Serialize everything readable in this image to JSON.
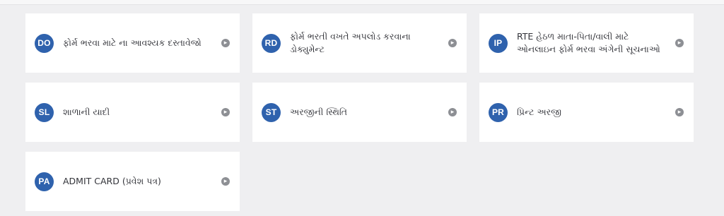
{
  "cards": [
    {
      "badge": "DO",
      "label": "ફોર્મ ભરવા માટે ના આવશ્યક દસ્તાવેજો",
      "arrow_icon": "arrow-right-circle-icon"
    },
    {
      "badge": "RD",
      "label": "ફોર્મ ભરતી વખતે અપલોડ કરવાના ડોક્યુમેન્ટ",
      "arrow_icon": "arrow-right-circle-icon"
    },
    {
      "badge": "IP",
      "label": "RTE હેઠળ માતા-પિતા/વાલી માટે ઓનલાઇન ફોર્મ ભરવા અંગેની સૂચનાઓ",
      "arrow_icon": "arrow-right-circle-icon"
    },
    {
      "badge": "SL",
      "label": "શાળાની યાદી",
      "arrow_icon": "arrow-right-circle-icon"
    },
    {
      "badge": "ST",
      "label": "અરજીની સ્થિતિ",
      "arrow_icon": "arrow-right-circle-icon"
    },
    {
      "badge": "PR",
      "label": "પ્રિન્ટ અરજી",
      "arrow_icon": "arrow-right-circle-icon"
    },
    {
      "badge": "PA",
      "label": "ADMIT CARD (પ્રવેશ પત્ર)",
      "arrow_icon": "arrow-right-circle-icon"
    }
  ],
  "colors": {
    "badge_bg": "#2f62ad",
    "page_bg": "#efeff1",
    "card_bg": "#ffffff",
    "arrow_bg": "#8d8f94"
  }
}
